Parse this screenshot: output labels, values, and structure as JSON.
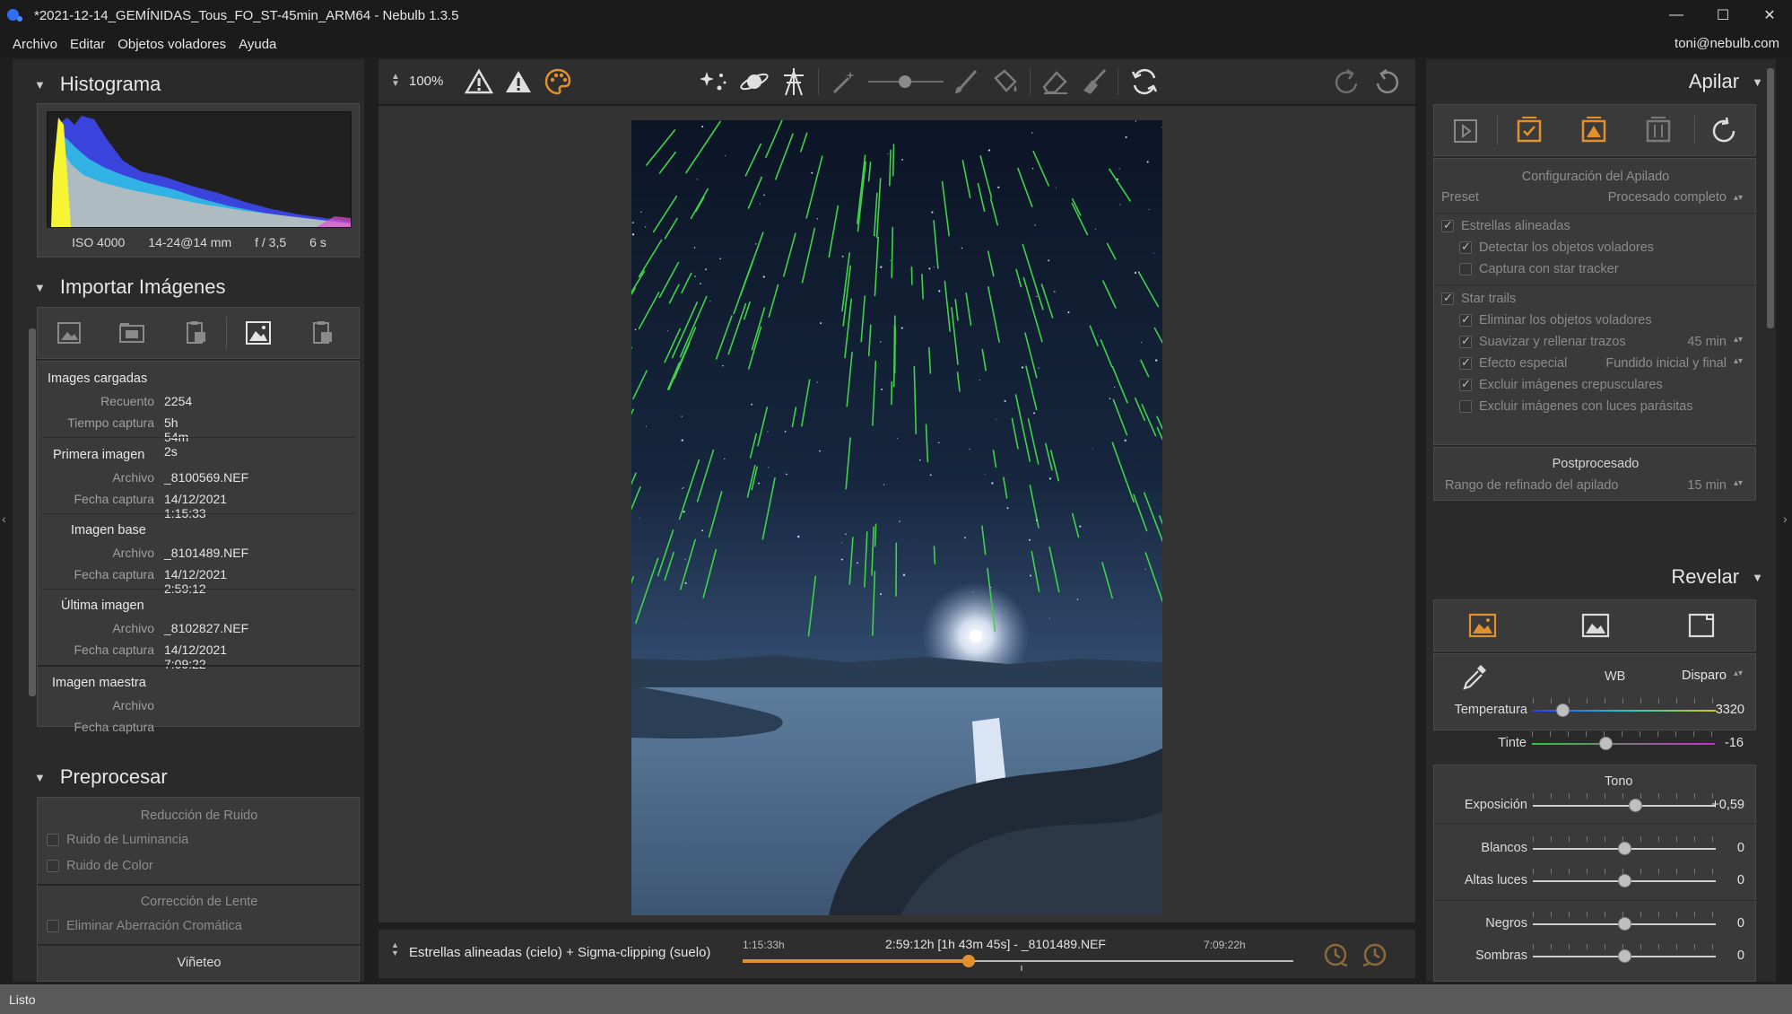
{
  "window": {
    "title": "*2021-12-14_GEMÍNIDAS_Tous_FO_ST-45min_ARM64 - Nebulb 1.3.5"
  },
  "menu": {
    "items": [
      "Archivo",
      "Editar",
      "Objetos voladores",
      "Ayuda"
    ],
    "user": "toni@nebulb.com"
  },
  "left": {
    "histogram": {
      "title": "Histograma",
      "iso": "ISO 4000",
      "lens": "14-24@14 mm",
      "aperture": "f / 3,5",
      "exposure": "6 s"
    },
    "import": {
      "title": "Importar Imágenes",
      "loaded": {
        "title": "Images cargadas",
        "count_label": "Recuento",
        "count": "2254",
        "time_label": "Tiempo captura",
        "time": "5h 54m 2s"
      },
      "first": {
        "title": "Primera imagen",
        "file_label": "Archivo",
        "file": "_8100569.NEF",
        "date_label": "Fecha captura",
        "date": "14/12/2021 1:15:33"
      },
      "base": {
        "title": "Imagen base",
        "file_label": "Archivo",
        "file": "_8101489.NEF",
        "date_label": "Fecha captura",
        "date": "14/12/2021 2:59:12"
      },
      "last": {
        "title": "Última imagen",
        "file_label": "Archivo",
        "file": "_8102827.NEF",
        "date_label": "Fecha captura",
        "date": "14/12/2021 7:09:22"
      },
      "master": {
        "title": "Imagen maestra",
        "file_label": "Archivo",
        "date_label": "Fecha captura"
      }
    },
    "preprocess": {
      "title": "Preprocesar",
      "noise_title": "Reducción de Ruido",
      "luminance": "Ruido de Luminancia",
      "color": "Ruido de Color",
      "lens_title": "Corrección de Lente",
      "chromatic": "Eliminar Aberración Cromática",
      "vignette": "Viñeteo"
    }
  },
  "toolbar": {
    "zoom": "100%"
  },
  "timeline": {
    "mode": "Estrellas alineadas (cielo) + Sigma-clipping (suelo)",
    "start": "1:15:33h",
    "current": "2:59:12h [1h 43m 45s] - _8101489.NEF",
    "end": "7:09:22h",
    "position": 0.41
  },
  "right": {
    "stack": {
      "title": "Apilar",
      "config_title": "Configuración del Apilado",
      "preset_label": "Preset",
      "preset_value": "Procesado completo",
      "aligned": "Estrellas alineadas",
      "detect": "Detectar los objetos voladores",
      "tracker": "Captura con star tracker",
      "trails": "Star trails",
      "remove": "Eliminar los objetos voladores",
      "smooth": "Suavizar y rellenar trazos",
      "smooth_value": "45 min",
      "effect": "Efecto especial",
      "effect_value": "Fundido inicial y final",
      "twilight": "Excluir imágenes crepusculares",
      "parasitic": "Excluir imágenes con luces parásitas",
      "post_title": "Postprocesado",
      "refine_label": "Rango de refinado del apilado",
      "refine_value": "15 min"
    },
    "develop": {
      "title": "Revelar",
      "wb_label": "WB",
      "wb_value": "Disparo",
      "temperature_label": "Temperatura",
      "temperature_value": "3320",
      "temperature_pos": 0.16,
      "tint_label": "Tinte",
      "tint_value": "-16",
      "tint_pos": 0.4,
      "tone_title": "Tono",
      "exposure_label": "Exposición",
      "exposure_value": "+0,59",
      "exposure_pos": 0.56,
      "whites_label": "Blancos",
      "whites_value": "0",
      "highlights_label": "Altas luces",
      "highlights_value": "0",
      "blacks_label": "Negros",
      "blacks_value": "0",
      "shadows_label": "Sombras",
      "shadows_value": "0"
    }
  },
  "status": {
    "text": "Listo"
  },
  "colors": {
    "accent_orange": "#e0912e",
    "trail_green": "#3fd24a",
    "panel_bg": "#2a2a2a",
    "box_bg": "#3a3a3a"
  }
}
